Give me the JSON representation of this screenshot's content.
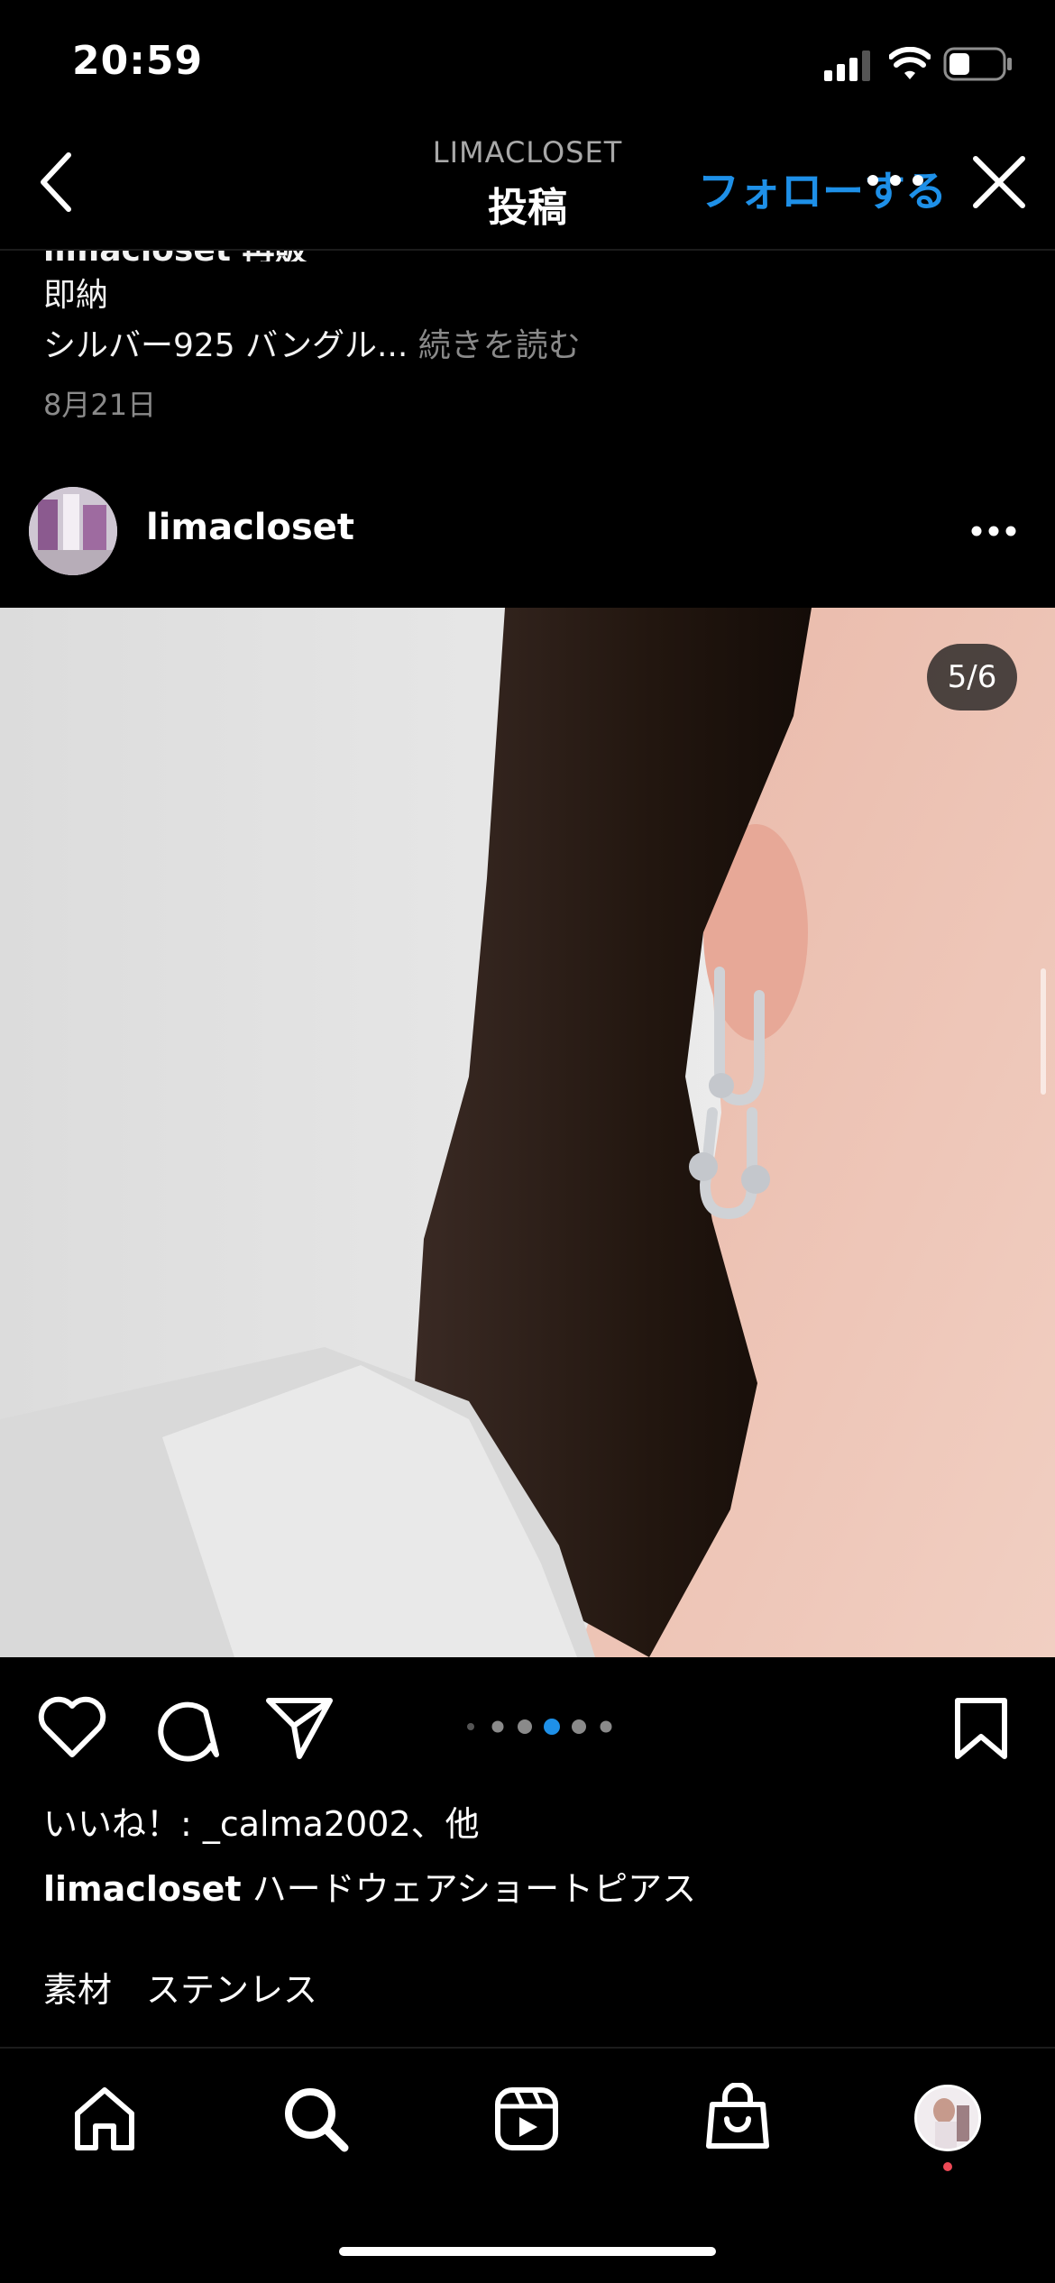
{
  "status_bar": {
    "time": "20:59"
  },
  "header": {
    "account": "LIMACLOSET",
    "title": "投稿",
    "follow_label": "フォローする"
  },
  "previous_post": {
    "cut_line": "limacloset 再販",
    "line1": "即納",
    "line2": "シルバー925 バングル...",
    "more_label": "続きを読む",
    "date": "8月21日"
  },
  "post": {
    "username": "limacloset",
    "counter": "5/6",
    "carousel": {
      "count": 6,
      "active_index": 3
    },
    "likes_text": "いいね！: _calma2002、他",
    "caption_user": "limacloset",
    "caption_text": " ハードウェアショートピアス",
    "material_text": "素材　ステンレス"
  },
  "colors": {
    "accent_blue": "#1e90e8",
    "background": "#000000",
    "badge_red": "#ed4956"
  },
  "icons": [
    "back-icon",
    "more-icon",
    "close-icon",
    "heart-icon",
    "comment-icon",
    "share-icon",
    "bookmark-icon",
    "home-icon",
    "search-icon",
    "reels-icon",
    "shop-icon"
  ]
}
